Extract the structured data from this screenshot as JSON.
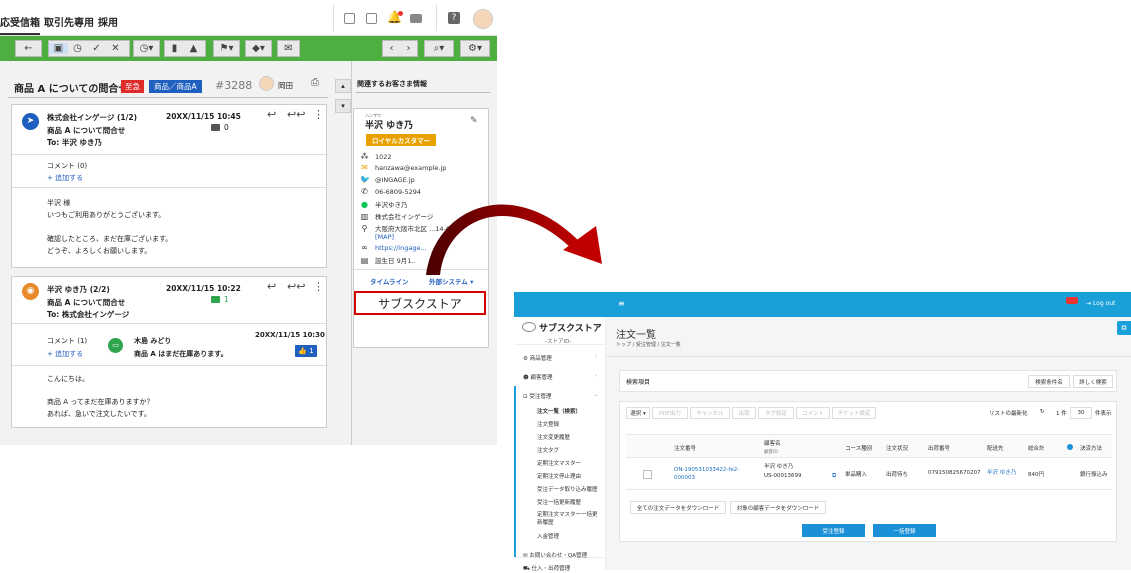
{
  "nav": {
    "tabs": [
      "応受信箱",
      "取引先専用",
      "採用"
    ]
  },
  "ticket": {
    "title": "商品 A についての問合せ",
    "tag_urgent": "至急",
    "tag_product": "商品／商品A",
    "number": "#3288",
    "assignee": "岡田"
  },
  "message1": {
    "sender": "株式会社インゲージ (1/2)",
    "date": "20XX/11/15 10:45",
    "subject": "商品 A について問合せ",
    "to": "To: 半沢 ゆき乃",
    "comment_count": "0",
    "comment_label": "コメント (0)",
    "add_label": "+ 追加する",
    "body": [
      "半沢 様",
      "いつもご利用ありがとうございます。",
      "",
      "確認したところ、まだ在庫ございます。",
      "どうぞ、よろしくお願いします。"
    ]
  },
  "message2": {
    "sender": "半沢 ゆき乃 (2/2)",
    "date": "20XX/11/15 10:22",
    "subject": "商品 A について問合せ",
    "to": "To: 株式会社インゲージ",
    "comment_count": "1",
    "comment_label": "コメント (1)",
    "add_label": "+ 追加する",
    "comment_author": "木島 みどり",
    "comment_date": "20XX/11/15 10:30",
    "comment_text": "商品 A はまだ在庫あります。",
    "like_count": "1",
    "body": [
      "こんにちは。",
      "",
      "商品 A ってまだ在庫ありますか？",
      "あれば、急いで注文したいです。"
    ]
  },
  "customer": {
    "section_title": "関連するお客さま情報",
    "kana": "ハンザワ",
    "name": "半沢 ゆき乃",
    "badge": "ロイヤルカスタマー",
    "id": "1022",
    "email": "hanzawa@example.jp",
    "twitter": "@INGAGE.jp",
    "phone": "06-6809-5294",
    "line": "半沢ゆき乃",
    "company": "株式会社インゲージ",
    "address": "大阪府大阪市北区 ...14-6",
    "map": "[MAP]",
    "url": "https://ingage...",
    "birthday": "誕生日 9月1..",
    "timeline": "タイムライン",
    "external": "外部システム ▾"
  },
  "callout": {
    "label": "サブスクストア"
  },
  "subs": {
    "logo": "サブスクストア",
    "store_id": "-ストアID-",
    "logout": "Log out",
    "page_title": "注文一覧",
    "breadcrumb": "トップ / 受注管理 / 注文一覧",
    "search_section": "検索項目",
    "search_conditions": "検索条件名",
    "detail_search": "詳しく検索",
    "select": "選択 ▾",
    "pdf": "PDF出力",
    "cancel": "キャンセル",
    "ship": "出荷",
    "tag": "タグ設定",
    "comment": "コメント",
    "ticket": "チケット設定",
    "refresh": "リストの最新化",
    "count": "1 件",
    "per_page": "30",
    "per_page_label": "件表示",
    "sidebar": [
      "商品管理",
      "顧客管理",
      "受注管理",
      "注文一覧（検索）",
      "注文登録",
      "注文変更履歴",
      "注文タグ",
      "定期注文マスター",
      "定期注文停止理由",
      "受注データ取り込み履歴",
      "受注一括更新履歴",
      "定期注文マスター一括更新履歴",
      "入金管理",
      "お問い合わせ・QA管理",
      "仕入・出荷管理"
    ],
    "columns": [
      "注文番号",
      "顧客名",
      "コース種別",
      "注文状況",
      "出荷番号",
      "配送先",
      "総合計",
      "決済方法"
    ],
    "customer_id_label": "顧客ID",
    "row": {
      "order_no": "ON-190531033422-fe2-000003",
      "customer": "半沢 ゆき乃",
      "customer_id": "US-00013699",
      "course": "単品購入",
      "status": "出荷待ち",
      "shipping_no": "079150825670207",
      "destination": "半沢 ゆき乃",
      "total": "840円",
      "payment": "銀行振込み"
    },
    "dl_all": "全ての注文データをダウンロード",
    "dl_customers": "対象の顧客データをダウンロード",
    "order_register": "受注登録",
    "bulk_register": "一括登録"
  }
}
